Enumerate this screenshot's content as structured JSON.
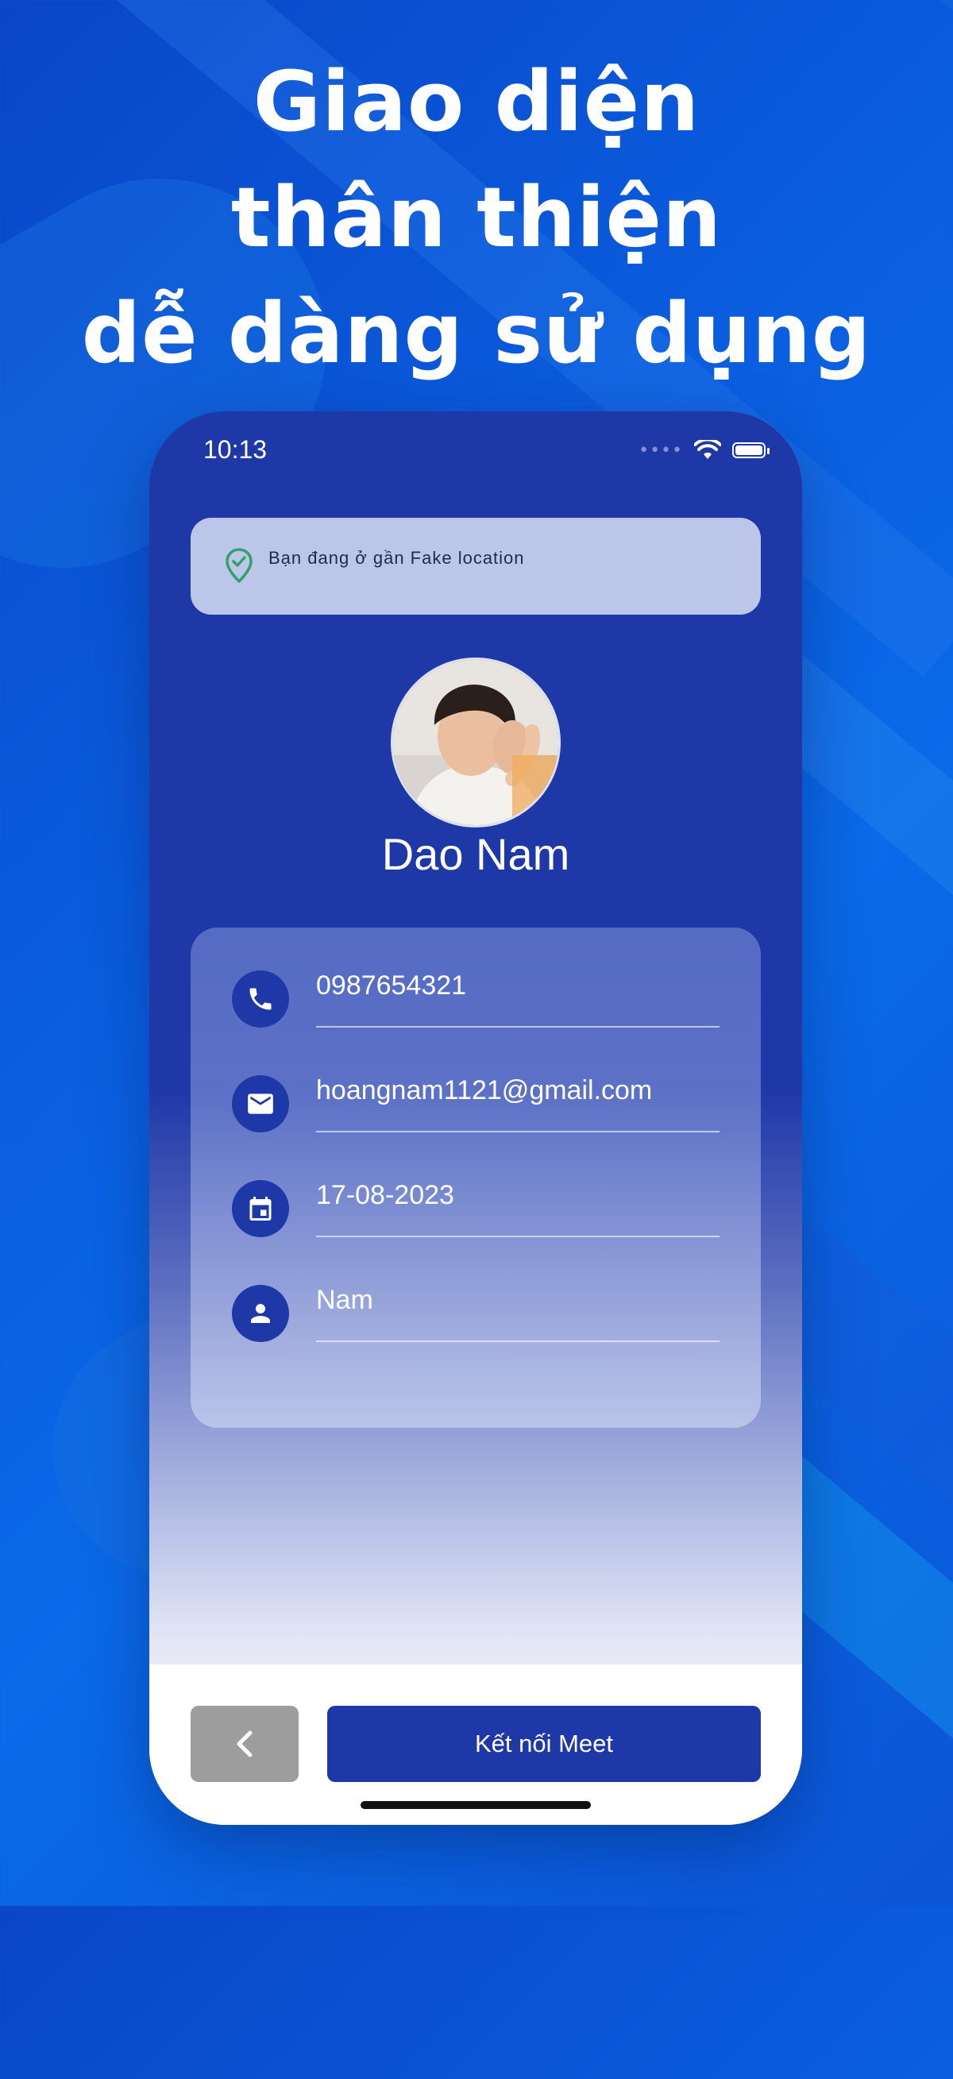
{
  "promo": {
    "line1": "Giao diện",
    "line2": "thân thiện",
    "line3": "dễ dàng sử dụng"
  },
  "status_bar": {
    "time": "10:13",
    "signal_icon": "signal-dots-icon",
    "wifi_icon": "wifi-icon",
    "battery_icon": "battery-icon"
  },
  "location_banner": {
    "text": "Bạn đang ở gần Fake location",
    "icon": "location-check-icon",
    "icon_color": "#2fa36b"
  },
  "profile": {
    "name": "Dao Nam",
    "avatar_icon": "avatar-photo"
  },
  "info": {
    "phone": "0987654321",
    "email": "hoangnam1121@gmail.com",
    "date": "17-08-2023",
    "gender": "Nam"
  },
  "actions": {
    "back_icon": "chevron-left-icon",
    "connect_label": "Kết nối Meet"
  },
  "colors": {
    "primary": "#1f38a8",
    "background": "#0a5fe0",
    "back_button": "#9d9d9d"
  }
}
